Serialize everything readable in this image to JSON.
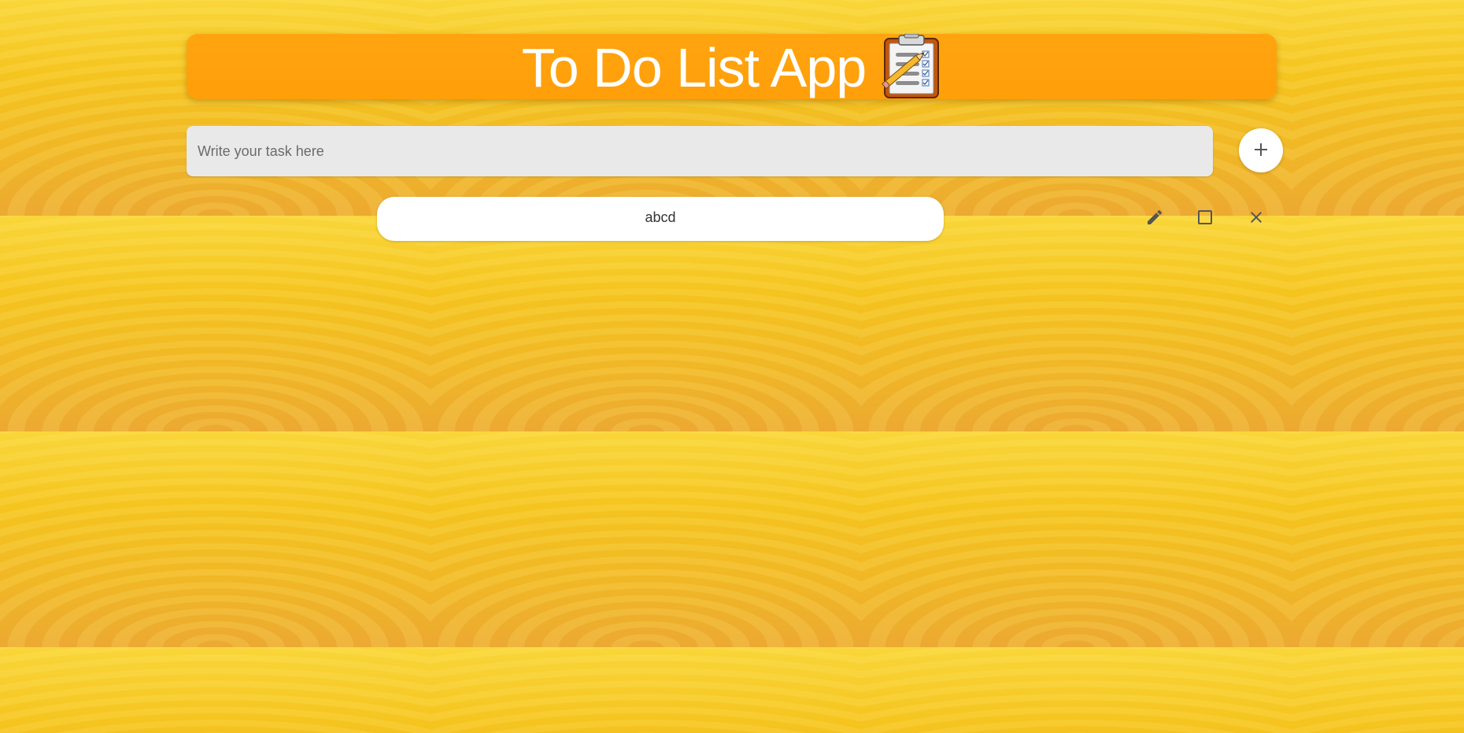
{
  "header": {
    "title": "To Do List App",
    "icon": "clipboard-checklist-icon"
  },
  "task_input": {
    "placeholder": "Write your task here",
    "value": ""
  },
  "add_button": {
    "icon": "plus-icon",
    "label": "+"
  },
  "tasks": [
    {
      "text": "abcd",
      "completed": false,
      "actions": [
        "edit-icon",
        "checkbox-icon",
        "close-icon"
      ]
    }
  ],
  "colors": {
    "header_bg": "#ffa40f",
    "background": "#f2b624",
    "input_bg": "#e9e9e9",
    "icon_color": "#555555"
  }
}
